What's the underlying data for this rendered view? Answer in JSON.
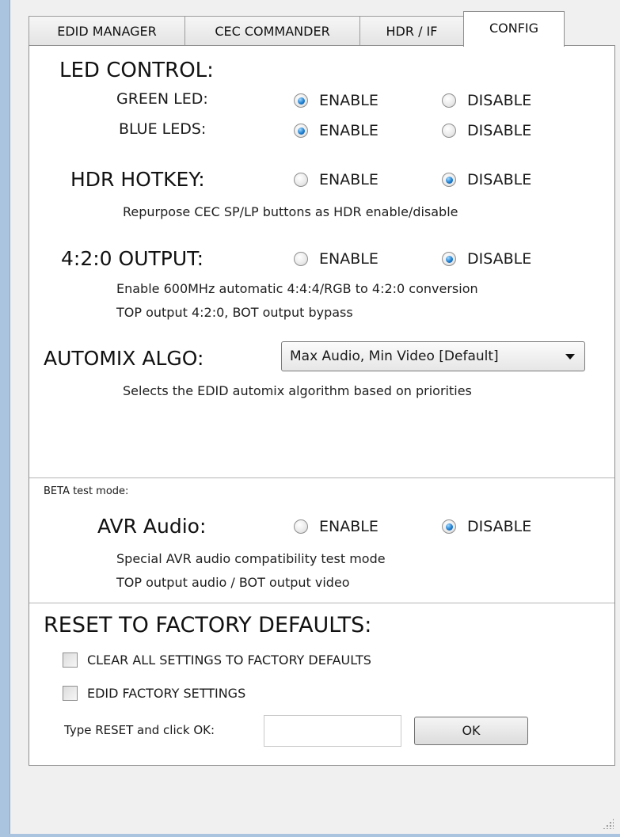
{
  "tabs": [
    {
      "label": "EDID MANAGER"
    },
    {
      "label": "CEC COMMANDER"
    },
    {
      "label": "HDR / IF"
    },
    {
      "label": "CONFIG"
    }
  ],
  "radio_labels": {
    "enable": "ENABLE",
    "disable": "DISABLE"
  },
  "led_control": {
    "heading": "LED CONTROL:",
    "green_label": "GREEN LED:",
    "green_selected": "ENABLE",
    "blue_label": "BLUE LEDS:",
    "blue_selected": "ENABLE"
  },
  "hdr_hotkey": {
    "heading": "HDR HOTKEY:",
    "selected": "DISABLE",
    "description": "Repurpose CEC SP/LP buttons as HDR enable/disable"
  },
  "output_420": {
    "heading": "4:2:0 OUTPUT:",
    "selected": "DISABLE",
    "description_line1": "Enable 600MHz automatic 4:4:4/RGB to 4:2:0 conversion",
    "description_line2": "TOP output 4:2:0, BOT output bypass"
  },
  "automix": {
    "heading": "AUTOMIX ALGO:",
    "selected_value": "Max Audio, Min Video [Default]",
    "description": "Selects the EDID automix algorithm based on priorities"
  },
  "beta": {
    "label": "BETA test mode:",
    "avr_heading": "AVR Audio:",
    "selected": "DISABLE",
    "description_line1": "Special AVR audio compatibility test mode",
    "description_line2": "TOP output audio / BOT output video"
  },
  "reset": {
    "heading": "RESET TO FACTORY DEFAULTS:",
    "clear_all_label": "CLEAR ALL SETTINGS TO FACTORY DEFAULTS",
    "edid_factory_label": "EDID FACTORY SETTINGS",
    "prompt_label": "Type RESET and click OK:",
    "input_value": "",
    "ok_label": "OK"
  },
  "colors": {
    "radio_selected": "#1f7fd0",
    "window_border": "#aac4df"
  }
}
